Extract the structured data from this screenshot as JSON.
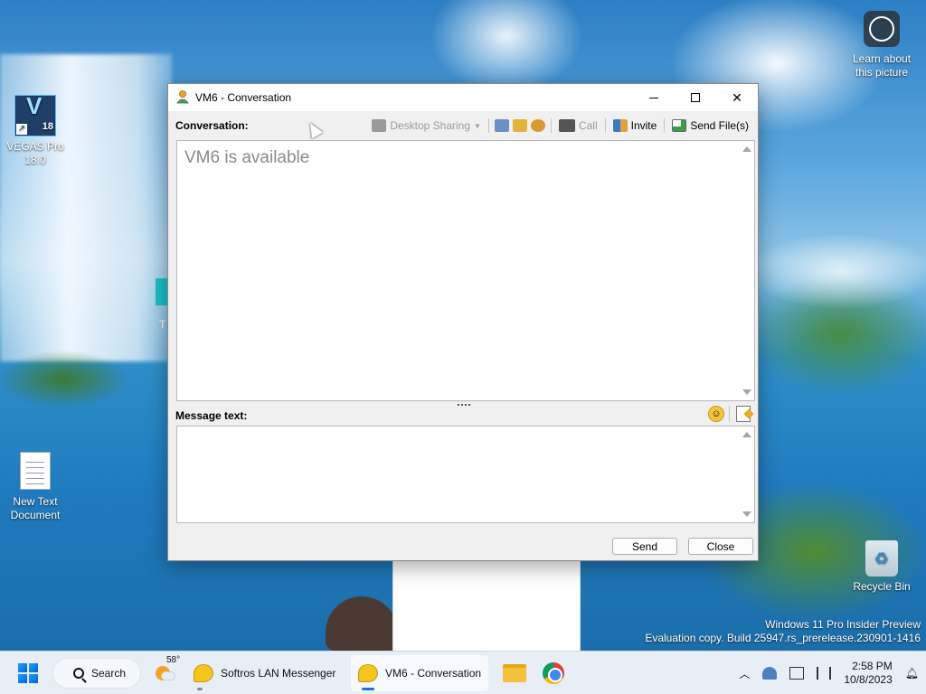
{
  "desktop": {
    "icons": [
      {
        "label": "VEGAS Pro 18.0",
        "tile_letter": "V",
        "tile_num": "18"
      },
      {
        "label": "New Text Document"
      },
      {
        "label": "Learn about this picture"
      },
      {
        "label": "Recycle Bin"
      }
    ],
    "watermark_line1": "Windows 11 Pro Insider Preview",
    "watermark_line2": "Evaluation copy. Build 25947.rs_prerelease.230901-1416",
    "partial_icon_label": "T"
  },
  "window": {
    "title": "VM6 - Conversation",
    "conversation_label": "Conversation:",
    "toolbar": {
      "desktop_sharing": "Desktop Sharing",
      "call": "Call",
      "invite": "Invite",
      "send_files": "Send File(s)"
    },
    "status_text": "VM6 is available",
    "message_label": "Message text:",
    "message_value": "",
    "send_label": "Send",
    "close_label": "Close"
  },
  "taskbar": {
    "search_label": "Search",
    "weather_temp": "58°",
    "apps": [
      {
        "label": "Softros LAN Messenger"
      },
      {
        "label": "VM6 - Conversation"
      }
    ],
    "time": "2:58 PM",
    "date": "10/8/2023"
  },
  "colors": {
    "taskbar_bg": "#e8eef6",
    "accent": "#1a73d8",
    "window_bg": "#f0f0f0"
  }
}
